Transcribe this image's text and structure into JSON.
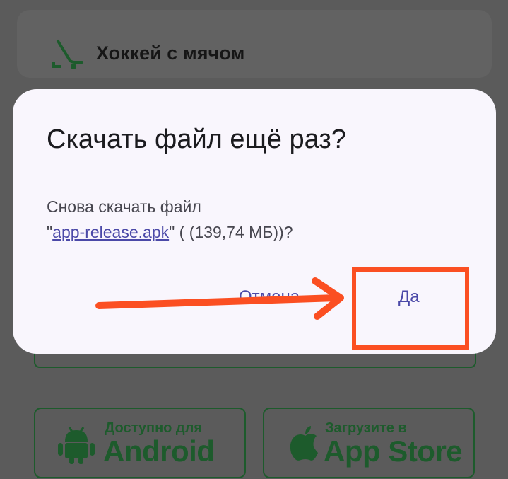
{
  "background_list": {
    "sport_item_label": "Хоккей с мячом",
    "sport_item_icon": "hockey-stick-icon"
  },
  "store_buttons": {
    "android": {
      "small_text": "Доступно для",
      "big_text": "Android",
      "icon": "android-icon"
    },
    "apple": {
      "small_text": "Загрузите в",
      "big_text": "App Store",
      "icon": "apple-icon"
    }
  },
  "dialog": {
    "title": "Скачать файл ещё раз?",
    "message_prefix": "Снова скачать файл",
    "quote_open": "\"",
    "file_link": "app-release.apk",
    "message_suffix": "\" ( (139,74 МБ))?",
    "cancel_label": "Отмена",
    "confirm_label": "Да"
  },
  "colors": {
    "accent": "#4b49a8",
    "annotation": "#fb4f22",
    "store_green": "#1d5b2c"
  }
}
